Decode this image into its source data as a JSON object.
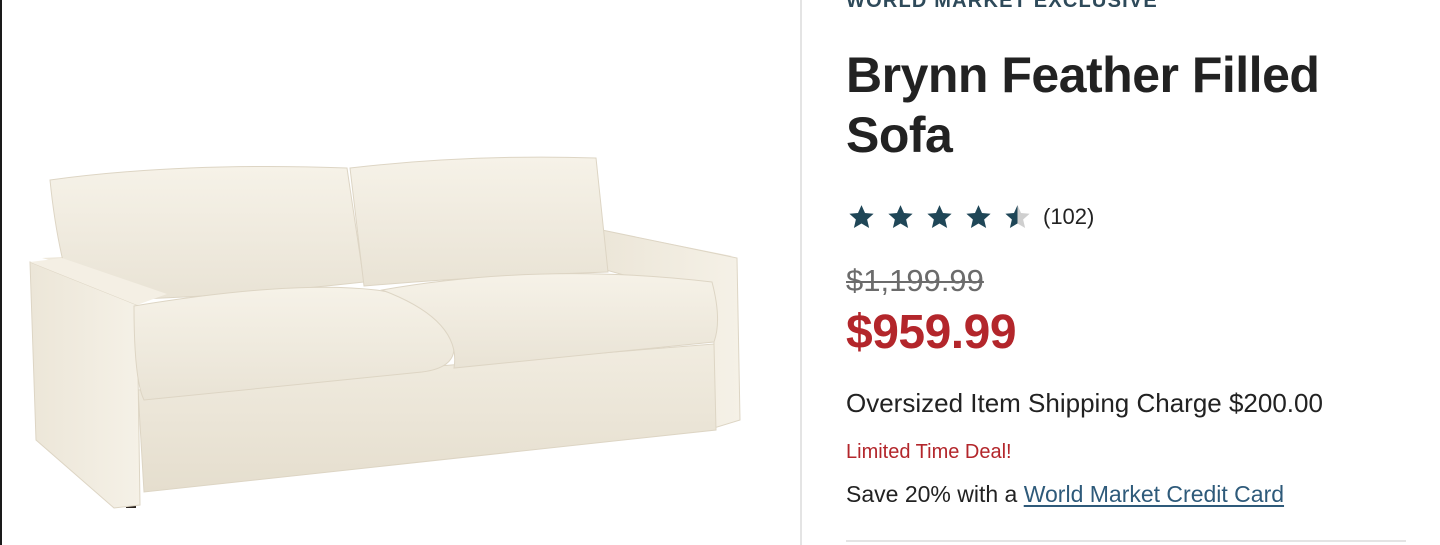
{
  "product": {
    "eyebrow": "WORLD MARKET EXCLUSIVE",
    "title": "Brynn Feather Filled Sofa",
    "image_alt": "Brynn Feather Filled Sofa",
    "rating": {
      "value": 4.5,
      "max": 5,
      "count_label": "(102)",
      "star_color": "#1f4657",
      "empty_star_color": "#cfcfcf"
    },
    "price": {
      "was": "$1,199.99",
      "now": "$959.99",
      "sale_color": "#b3262b"
    },
    "shipping_text": "Oversized Item Shipping Charge $200.00",
    "deal_label": "Limited Time Deal!",
    "promo": {
      "prefix": "Save 20% with a",
      "link_label": "World Market Credit Card"
    }
  }
}
